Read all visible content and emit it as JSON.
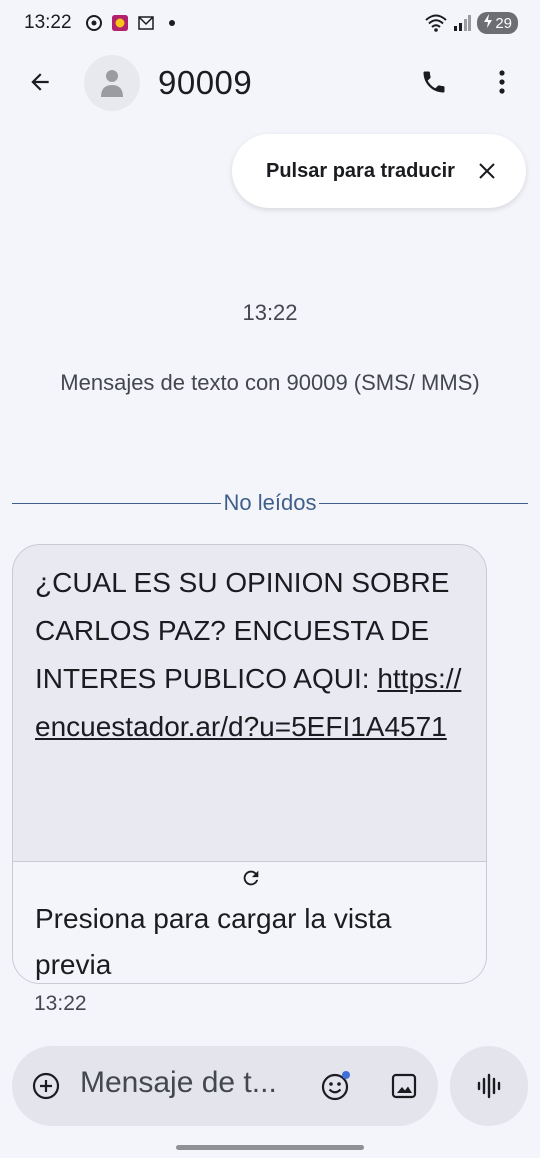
{
  "status_bar": {
    "time": "13:22",
    "battery": "29"
  },
  "header": {
    "title": "90009"
  },
  "translate_chip": {
    "label": "Pulsar para traducir"
  },
  "conversation": {
    "start_time": "13:22",
    "info": "Mensajes de texto con 90009 (SMS/ MMS)",
    "unread_label": "No leídos"
  },
  "message": {
    "text": "¿CUAL ES SU OPINION SOBRE CARLOS PAZ? ENCUESTA DE INTERES PUBLICO AQUI:",
    "link": "https://encuestador.ar/d?u=5EFI1A4571",
    "preview_label": "Presiona para cargar la vista previa",
    "time": "13:22"
  },
  "compose": {
    "placeholder": "Mensaje de t..."
  },
  "colors": {
    "background": "#f4f5fb",
    "bubble": "#e8e9f1",
    "accent": "#3f5f8a"
  }
}
